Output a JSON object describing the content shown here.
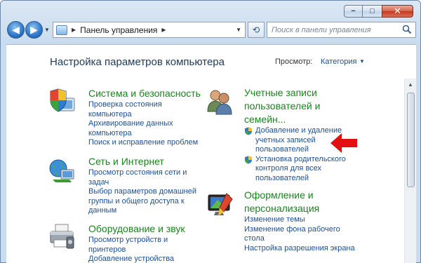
{
  "window": {
    "minimize_glyph": "−",
    "maximize_glyph": "□",
    "close_glyph": "✕"
  },
  "nav": {
    "back_glyph": "◀",
    "forward_glyph": "▶",
    "recent_glyph": "▼"
  },
  "address": {
    "breadcrumb": "Панель управления",
    "separator": "▶",
    "dropdown": "▼"
  },
  "refresh_glyph": "⟲",
  "search": {
    "placeholder": "Поиск в панели управления"
  },
  "main": {
    "title": "Настройка параметров компьютера",
    "view_label": "Просмотр:",
    "view_value": "Категория",
    "view_arrow": "▼"
  },
  "categories": [
    {
      "title": "Система и безопасность",
      "icon": "shield-computer-icon",
      "links": [
        "Проверка состояния",
        "компьютера",
        "Архивирование данных",
        "компьютера",
        "Поиск и исправление проблем"
      ]
    },
    {
      "title": "Сеть и Интернет",
      "icon": "network-globe-icon",
      "links": [
        "Просмотр состояния сети и",
        "задач",
        "Выбор параметров домашней",
        "группы и общего доступа к",
        "данным"
      ]
    },
    {
      "title": "Оборудование и звук",
      "icon": "printer-icon",
      "links": [
        "Просмотр устройств и",
        "принтеров",
        "Добавление устройства"
      ]
    },
    {
      "title_lines": [
        "Учетные записи",
        "пользователей и",
        "семейн..."
      ],
      "icon": "users-icon",
      "links": [
        "Добавление и удаление",
        "учетных записей",
        "пользователей",
        "Установка родительского",
        "контроля для всех",
        "пользователей"
      ]
    },
    {
      "title_lines": [
        "Оформление и",
        "персонализация"
      ],
      "icon": "monitor-paint-icon",
      "links": [
        "Изменение темы",
        "Изменение фона рабочего",
        "стола",
        "Настройка разрешения экрана"
      ]
    }
  ],
  "colors": {
    "category_title": "#17861b",
    "link": "#1e4f9c",
    "heading": "#1e395b",
    "arrow": "#e21010"
  }
}
